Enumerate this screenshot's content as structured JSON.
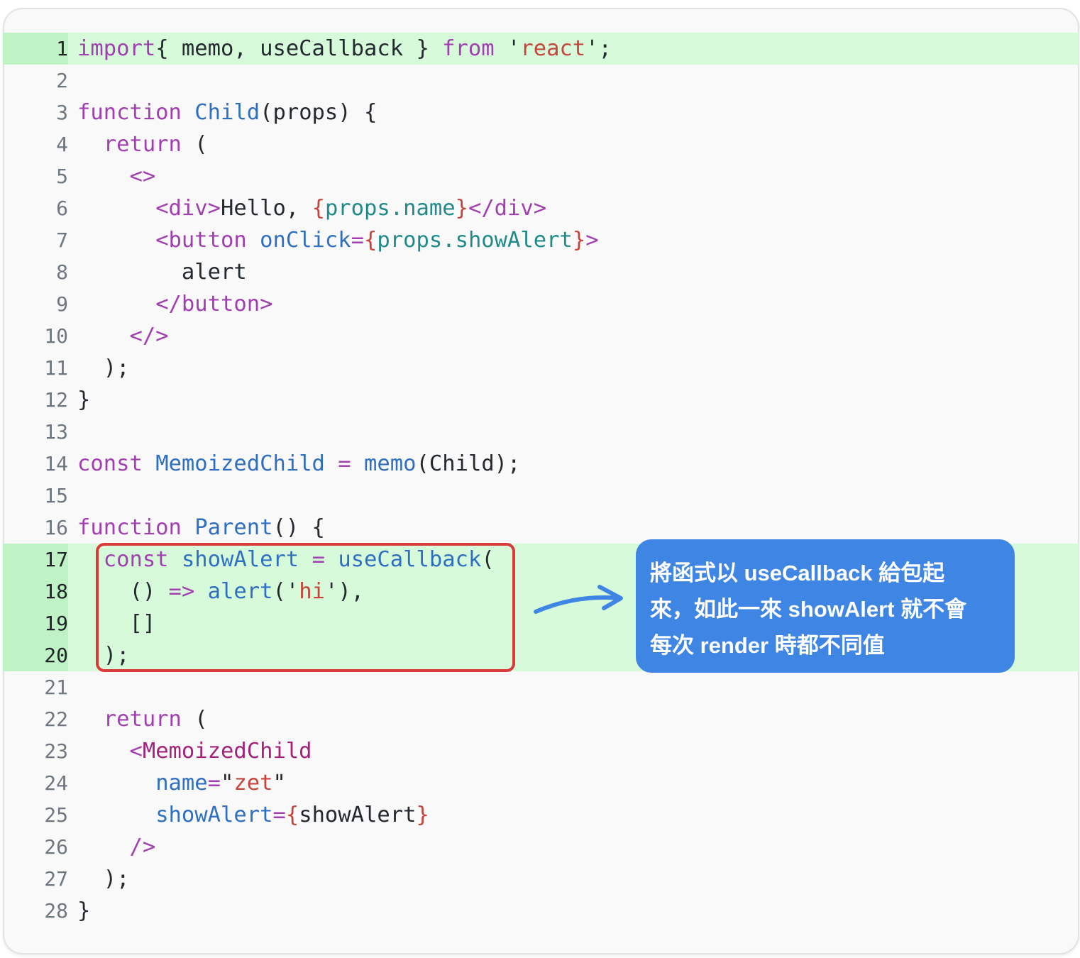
{
  "code": {
    "lines": [
      {
        "n": "1",
        "tokens": [
          [
            "kw",
            "import"
          ],
          [
            "",
            "{ memo, useCallback } "
          ],
          [
            "kw",
            "from"
          ],
          [
            "",
            " '"
          ],
          [
            "str",
            "react"
          ],
          [
            "",
            "';"
          ]
        ]
      },
      {
        "n": "2",
        "tokens": []
      },
      {
        "n": "3",
        "tokens": [
          [
            "kw",
            "function"
          ],
          [
            "",
            " "
          ],
          [
            "fnc",
            "Child"
          ],
          [
            "",
            "(props) {"
          ]
        ]
      },
      {
        "n": "4",
        "tokens": [
          [
            "",
            "  "
          ],
          [
            "kw",
            "return"
          ],
          [
            "",
            " ("
          ]
        ]
      },
      {
        "n": "5",
        "tokens": [
          [
            "",
            "    "
          ],
          [
            "tag",
            "<>"
          ]
        ]
      },
      {
        "n": "6",
        "tokens": [
          [
            "",
            "      "
          ],
          [
            "tag",
            "<div>"
          ],
          [
            "",
            "Hello, "
          ],
          [
            "brc",
            "{"
          ],
          [
            "prop",
            "props.name"
          ],
          [
            "brc",
            "}"
          ],
          [
            "tag",
            "</div>"
          ]
        ]
      },
      {
        "n": "7",
        "tokens": [
          [
            "",
            "      "
          ],
          [
            "tag",
            "<button"
          ],
          [
            "",
            " "
          ],
          [
            "attr",
            "onClick"
          ],
          [
            "tag",
            "="
          ],
          [
            "brc",
            "{"
          ],
          [
            "prop",
            "props.showAlert"
          ],
          [
            "brc",
            "}"
          ],
          [
            "tag",
            ">"
          ]
        ]
      },
      {
        "n": "8",
        "tokens": [
          [
            "",
            "        alert"
          ]
        ]
      },
      {
        "n": "9",
        "tokens": [
          [
            "",
            "      "
          ],
          [
            "tag",
            "</button>"
          ]
        ]
      },
      {
        "n": "10",
        "tokens": [
          [
            "",
            "    "
          ],
          [
            "tag",
            "</>"
          ]
        ]
      },
      {
        "n": "11",
        "tokens": [
          [
            "",
            "  );"
          ]
        ]
      },
      {
        "n": "12",
        "tokens": [
          [
            "",
            "}"
          ]
        ]
      },
      {
        "n": "13",
        "tokens": []
      },
      {
        "n": "14",
        "tokens": [
          [
            "kw",
            "const"
          ],
          [
            "",
            " "
          ],
          [
            "fnc",
            "MemoizedChild"
          ],
          [
            "",
            " "
          ],
          [
            "op",
            "="
          ],
          [
            "",
            " "
          ],
          [
            "fnc",
            "memo"
          ],
          [
            "",
            "(Child);"
          ]
        ]
      },
      {
        "n": "15",
        "tokens": []
      },
      {
        "n": "16",
        "tokens": [
          [
            "kw",
            "function"
          ],
          [
            "",
            " "
          ],
          [
            "fnc",
            "Parent"
          ],
          [
            "",
            "() {"
          ]
        ]
      },
      {
        "n": "17",
        "tokens": [
          [
            "",
            "  "
          ],
          [
            "kw",
            "const"
          ],
          [
            "",
            " "
          ],
          [
            "fnc",
            "showAlert"
          ],
          [
            "",
            " "
          ],
          [
            "op",
            "="
          ],
          [
            "",
            " "
          ],
          [
            "fnc",
            "useCallback"
          ],
          [
            "",
            "("
          ]
        ]
      },
      {
        "n": "18",
        "tokens": [
          [
            "",
            "    () "
          ],
          [
            "op",
            "=>"
          ],
          [
            "",
            " "
          ],
          [
            "fnc",
            "alert"
          ],
          [
            "",
            "('"
          ],
          [
            "str",
            "hi"
          ],
          [
            "",
            "'),"
          ]
        ]
      },
      {
        "n": "19",
        "tokens": [
          [
            "",
            "    []"
          ]
        ]
      },
      {
        "n": "20",
        "tokens": [
          [
            "",
            "  );"
          ]
        ]
      },
      {
        "n": "21",
        "tokens": []
      },
      {
        "n": "22",
        "tokens": [
          [
            "",
            "  "
          ],
          [
            "kw",
            "return"
          ],
          [
            "",
            " ("
          ]
        ]
      },
      {
        "n": "23",
        "tokens": [
          [
            "",
            "    "
          ],
          [
            "tag",
            "<"
          ],
          [
            "comp",
            "MemoizedChild"
          ]
        ]
      },
      {
        "n": "24",
        "tokens": [
          [
            "",
            "      "
          ],
          [
            "attr",
            "name"
          ],
          [
            "tag",
            "="
          ],
          [
            "",
            "\""
          ],
          [
            "str",
            "zet"
          ],
          [
            "",
            "\""
          ]
        ]
      },
      {
        "n": "25",
        "tokens": [
          [
            "",
            "      "
          ],
          [
            "attr",
            "showAlert"
          ],
          [
            "tag",
            "="
          ],
          [
            "brc",
            "{"
          ],
          [
            "",
            "showAlert"
          ],
          [
            "brc",
            "}"
          ]
        ]
      },
      {
        "n": "26",
        "tokens": [
          [
            "",
            "    "
          ],
          [
            "tag",
            "/>"
          ]
        ]
      },
      {
        "n": "27",
        "tokens": [
          [
            "",
            "  );"
          ]
        ]
      },
      {
        "n": "28",
        "tokens": [
          [
            "",
            "}"
          ]
        ]
      }
    ],
    "highlighted_lines": [
      "1",
      "17",
      "18",
      "19",
      "20"
    ]
  },
  "callout": {
    "line1": "將函式以 useCallback 給包起",
    "line2": "來，如此一來 showAlert 就不會",
    "line3": "每次 render 時都不同值"
  },
  "colors": {
    "highlight_bg": "#d7fadb",
    "callout_bg": "#3f86e4",
    "box_border": "#d93a3a",
    "arrow": "#3f86e4"
  }
}
